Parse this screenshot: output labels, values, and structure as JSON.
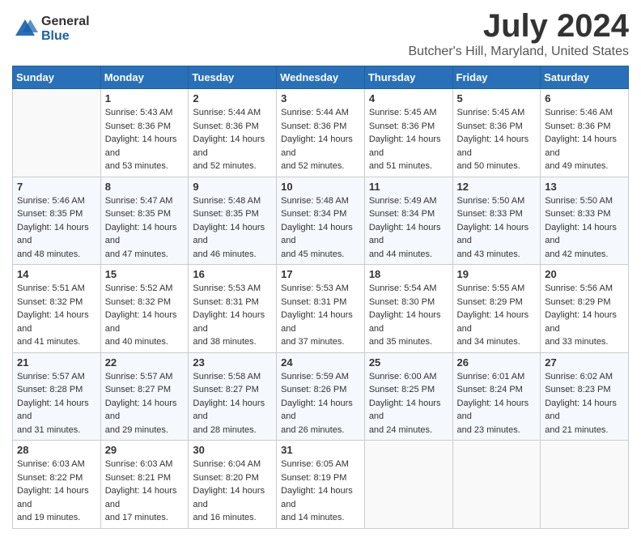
{
  "header": {
    "logo_general": "General",
    "logo_blue": "Blue",
    "month_title": "July 2024",
    "location": "Butcher's Hill, Maryland, United States"
  },
  "days_of_week": [
    "Sunday",
    "Monday",
    "Tuesday",
    "Wednesday",
    "Thursday",
    "Friday",
    "Saturday"
  ],
  "weeks": [
    [
      {
        "day": "",
        "sunrise": "",
        "sunset": "",
        "daylight": ""
      },
      {
        "day": "1",
        "sunrise": "Sunrise: 5:43 AM",
        "sunset": "Sunset: 8:36 PM",
        "daylight": "Daylight: 14 hours and 53 minutes."
      },
      {
        "day": "2",
        "sunrise": "Sunrise: 5:44 AM",
        "sunset": "Sunset: 8:36 PM",
        "daylight": "Daylight: 14 hours and 52 minutes."
      },
      {
        "day": "3",
        "sunrise": "Sunrise: 5:44 AM",
        "sunset": "Sunset: 8:36 PM",
        "daylight": "Daylight: 14 hours and 52 minutes."
      },
      {
        "day": "4",
        "sunrise": "Sunrise: 5:45 AM",
        "sunset": "Sunset: 8:36 PM",
        "daylight": "Daylight: 14 hours and 51 minutes."
      },
      {
        "day": "5",
        "sunrise": "Sunrise: 5:45 AM",
        "sunset": "Sunset: 8:36 PM",
        "daylight": "Daylight: 14 hours and 50 minutes."
      },
      {
        "day": "6",
        "sunrise": "Sunrise: 5:46 AM",
        "sunset": "Sunset: 8:36 PM",
        "daylight": "Daylight: 14 hours and 49 minutes."
      }
    ],
    [
      {
        "day": "7",
        "sunrise": "Sunrise: 5:46 AM",
        "sunset": "Sunset: 8:35 PM",
        "daylight": "Daylight: 14 hours and 48 minutes."
      },
      {
        "day": "8",
        "sunrise": "Sunrise: 5:47 AM",
        "sunset": "Sunset: 8:35 PM",
        "daylight": "Daylight: 14 hours and 47 minutes."
      },
      {
        "day": "9",
        "sunrise": "Sunrise: 5:48 AM",
        "sunset": "Sunset: 8:35 PM",
        "daylight": "Daylight: 14 hours and 46 minutes."
      },
      {
        "day": "10",
        "sunrise": "Sunrise: 5:48 AM",
        "sunset": "Sunset: 8:34 PM",
        "daylight": "Daylight: 14 hours and 45 minutes."
      },
      {
        "day": "11",
        "sunrise": "Sunrise: 5:49 AM",
        "sunset": "Sunset: 8:34 PM",
        "daylight": "Daylight: 14 hours and 44 minutes."
      },
      {
        "day": "12",
        "sunrise": "Sunrise: 5:50 AM",
        "sunset": "Sunset: 8:33 PM",
        "daylight": "Daylight: 14 hours and 43 minutes."
      },
      {
        "day": "13",
        "sunrise": "Sunrise: 5:50 AM",
        "sunset": "Sunset: 8:33 PM",
        "daylight": "Daylight: 14 hours and 42 minutes."
      }
    ],
    [
      {
        "day": "14",
        "sunrise": "Sunrise: 5:51 AM",
        "sunset": "Sunset: 8:32 PM",
        "daylight": "Daylight: 14 hours and 41 minutes."
      },
      {
        "day": "15",
        "sunrise": "Sunrise: 5:52 AM",
        "sunset": "Sunset: 8:32 PM",
        "daylight": "Daylight: 14 hours and 40 minutes."
      },
      {
        "day": "16",
        "sunrise": "Sunrise: 5:53 AM",
        "sunset": "Sunset: 8:31 PM",
        "daylight": "Daylight: 14 hours and 38 minutes."
      },
      {
        "day": "17",
        "sunrise": "Sunrise: 5:53 AM",
        "sunset": "Sunset: 8:31 PM",
        "daylight": "Daylight: 14 hours and 37 minutes."
      },
      {
        "day": "18",
        "sunrise": "Sunrise: 5:54 AM",
        "sunset": "Sunset: 8:30 PM",
        "daylight": "Daylight: 14 hours and 35 minutes."
      },
      {
        "day": "19",
        "sunrise": "Sunrise: 5:55 AM",
        "sunset": "Sunset: 8:29 PM",
        "daylight": "Daylight: 14 hours and 34 minutes."
      },
      {
        "day": "20",
        "sunrise": "Sunrise: 5:56 AM",
        "sunset": "Sunset: 8:29 PM",
        "daylight": "Daylight: 14 hours and 33 minutes."
      }
    ],
    [
      {
        "day": "21",
        "sunrise": "Sunrise: 5:57 AM",
        "sunset": "Sunset: 8:28 PM",
        "daylight": "Daylight: 14 hours and 31 minutes."
      },
      {
        "day": "22",
        "sunrise": "Sunrise: 5:57 AM",
        "sunset": "Sunset: 8:27 PM",
        "daylight": "Daylight: 14 hours and 29 minutes."
      },
      {
        "day": "23",
        "sunrise": "Sunrise: 5:58 AM",
        "sunset": "Sunset: 8:27 PM",
        "daylight": "Daylight: 14 hours and 28 minutes."
      },
      {
        "day": "24",
        "sunrise": "Sunrise: 5:59 AM",
        "sunset": "Sunset: 8:26 PM",
        "daylight": "Daylight: 14 hours and 26 minutes."
      },
      {
        "day": "25",
        "sunrise": "Sunrise: 6:00 AM",
        "sunset": "Sunset: 8:25 PM",
        "daylight": "Daylight: 14 hours and 24 minutes."
      },
      {
        "day": "26",
        "sunrise": "Sunrise: 6:01 AM",
        "sunset": "Sunset: 8:24 PM",
        "daylight": "Daylight: 14 hours and 23 minutes."
      },
      {
        "day": "27",
        "sunrise": "Sunrise: 6:02 AM",
        "sunset": "Sunset: 8:23 PM",
        "daylight": "Daylight: 14 hours and 21 minutes."
      }
    ],
    [
      {
        "day": "28",
        "sunrise": "Sunrise: 6:03 AM",
        "sunset": "Sunset: 8:22 PM",
        "daylight": "Daylight: 14 hours and 19 minutes."
      },
      {
        "day": "29",
        "sunrise": "Sunrise: 6:03 AM",
        "sunset": "Sunset: 8:21 PM",
        "daylight": "Daylight: 14 hours and 17 minutes."
      },
      {
        "day": "30",
        "sunrise": "Sunrise: 6:04 AM",
        "sunset": "Sunset: 8:20 PM",
        "daylight": "Daylight: 14 hours and 16 minutes."
      },
      {
        "day": "31",
        "sunrise": "Sunrise: 6:05 AM",
        "sunset": "Sunset: 8:19 PM",
        "daylight": "Daylight: 14 hours and 14 minutes."
      },
      {
        "day": "",
        "sunrise": "",
        "sunset": "",
        "daylight": ""
      },
      {
        "day": "",
        "sunrise": "",
        "sunset": "",
        "daylight": ""
      },
      {
        "day": "",
        "sunrise": "",
        "sunset": "",
        "daylight": ""
      }
    ]
  ]
}
